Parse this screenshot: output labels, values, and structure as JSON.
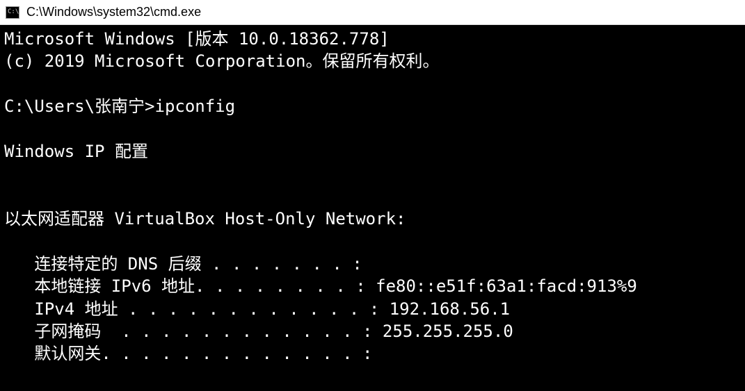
{
  "titlebar": {
    "title": "C:\\Windows\\system32\\cmd.exe"
  },
  "terminal": {
    "line1": "Microsoft Windows [版本 10.0.18362.778]",
    "line2": "(c) 2019 Microsoft Corporation。保留所有权利。",
    "blank1": "",
    "prompt": "C:\\Users\\张南宁>ipconfig",
    "blank2": "",
    "header": "Windows IP 配置",
    "blank3": "",
    "blank4": "",
    "adapter_header": "以太网适配器 VirtualBox Host-Only Network:",
    "blank5": "",
    "dns_suffix": "   连接特定的 DNS 后缀 . . . . . . . :",
    "ipv6": "   本地链接 IPv6 地址. . . . . . . . : fe80::e51f:63a1:facd:913%9",
    "ipv4": "   IPv4 地址 . . . . . . . . . . . . : 192.168.56.1",
    "subnet": "   子网掩码  . . . . . . . . . . . . : 255.255.255.0",
    "gateway": "   默认网关. . . . . . . . . . . . . :"
  }
}
